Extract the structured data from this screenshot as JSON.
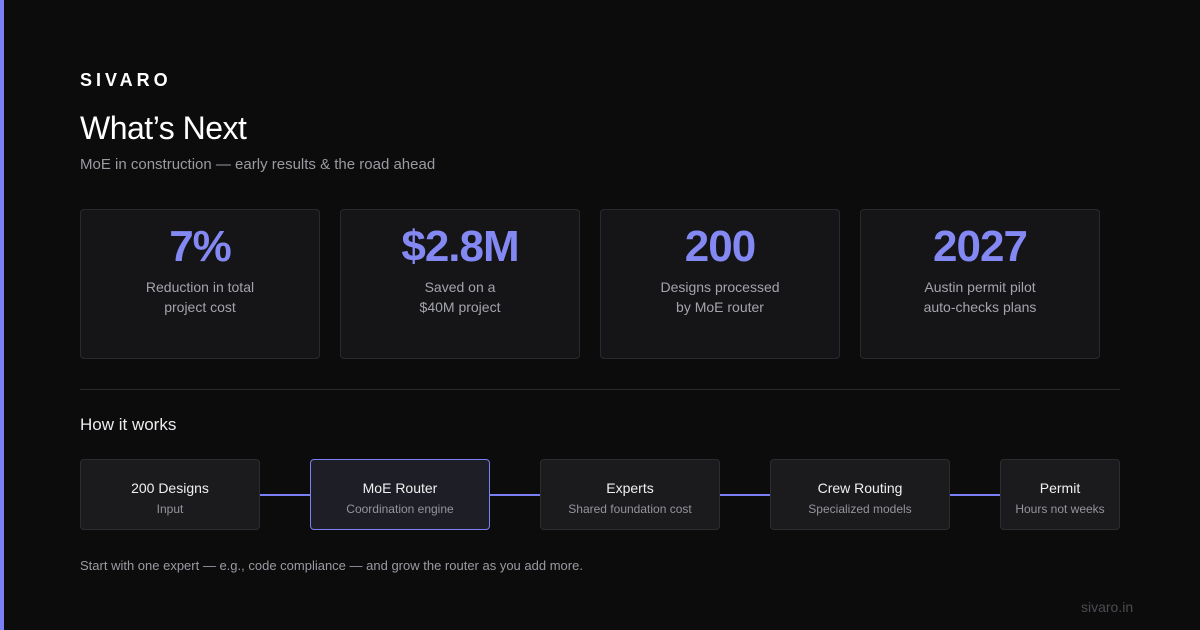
{
  "brand": "SIVARO",
  "title": "What’s Next",
  "subtitle": "MoE in construction — early results & the road ahead",
  "colors": {
    "background": "#0c0c0c",
    "accent": "#7b7ff5",
    "stat_value": "#8488f2",
    "card_background": "#151518"
  },
  "stats": [
    {
      "value": "7%",
      "label_lines": [
        "Reduction in total",
        "project cost"
      ]
    },
    {
      "value": "$2.8M",
      "label_lines": [
        "Saved on a",
        "$40M project"
      ]
    },
    {
      "value": "200",
      "label_lines": [
        "Designs processed",
        "by MoE router"
      ]
    },
    {
      "value": "2027",
      "label_lines": [
        "Austin permit pilot",
        "auto-checks plans"
      ]
    }
  ],
  "how_it_works": {
    "title": "How it works",
    "steps": [
      {
        "title": "200 Designs",
        "subtitle": "Input",
        "highlighted": false
      },
      {
        "title": "MoE Router",
        "subtitle": "Coordination engine",
        "highlighted": true
      },
      {
        "title": "Experts",
        "subtitle": "Shared foundation cost",
        "highlighted": false
      },
      {
        "title": "Crew Routing",
        "subtitle": "Specialized models",
        "highlighted": false
      },
      {
        "title": "Permit",
        "subtitle": "Hours not weeks",
        "highlighted": false
      }
    ]
  },
  "footnote": "Start with one expert — e.g., code compliance — and grow the router as you add more.",
  "site_url": "sivaro.in"
}
